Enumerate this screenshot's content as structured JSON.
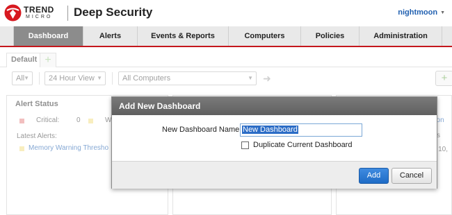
{
  "header": {
    "brand_top": "TREND",
    "brand_bottom": "MICRO",
    "product": "Deep Security",
    "user": "nightmoon",
    "logo_color": "#d71920"
  },
  "nav": {
    "items": [
      "Dashboard",
      "Alerts",
      "Events & Reports",
      "Computers",
      "Policies",
      "Administration"
    ],
    "active": "Dashboard",
    "accent": "#c4161c"
  },
  "tabs": {
    "items": [
      "Default"
    ],
    "add_icon": "plus-icon"
  },
  "toolbar": {
    "filter_value": "All",
    "view_value": "24 Hour View",
    "computers_value": "All Computers",
    "add_widget_icon": "plus-icon"
  },
  "widgets": {
    "alert_status": {
      "title": "Alert Status",
      "critical_label": "Critical:",
      "critical_count": "0",
      "warning_letter": "W",
      "latest_label": "Latest Alerts:",
      "latest_item": "Memory Warning Thresho"
    },
    "right": {
      "partial_1": "oon",
      "partial_2": "s",
      "partial_3": "r 10,"
    }
  },
  "dialog": {
    "title": "Add New Dashboard",
    "name_label": "New Dashboard Name:",
    "name_value": "New Dashboard",
    "duplicate_label": "Duplicate Current Dashboard",
    "duplicate_checked": false,
    "add_label": "Add",
    "cancel_label": "Cancel"
  }
}
